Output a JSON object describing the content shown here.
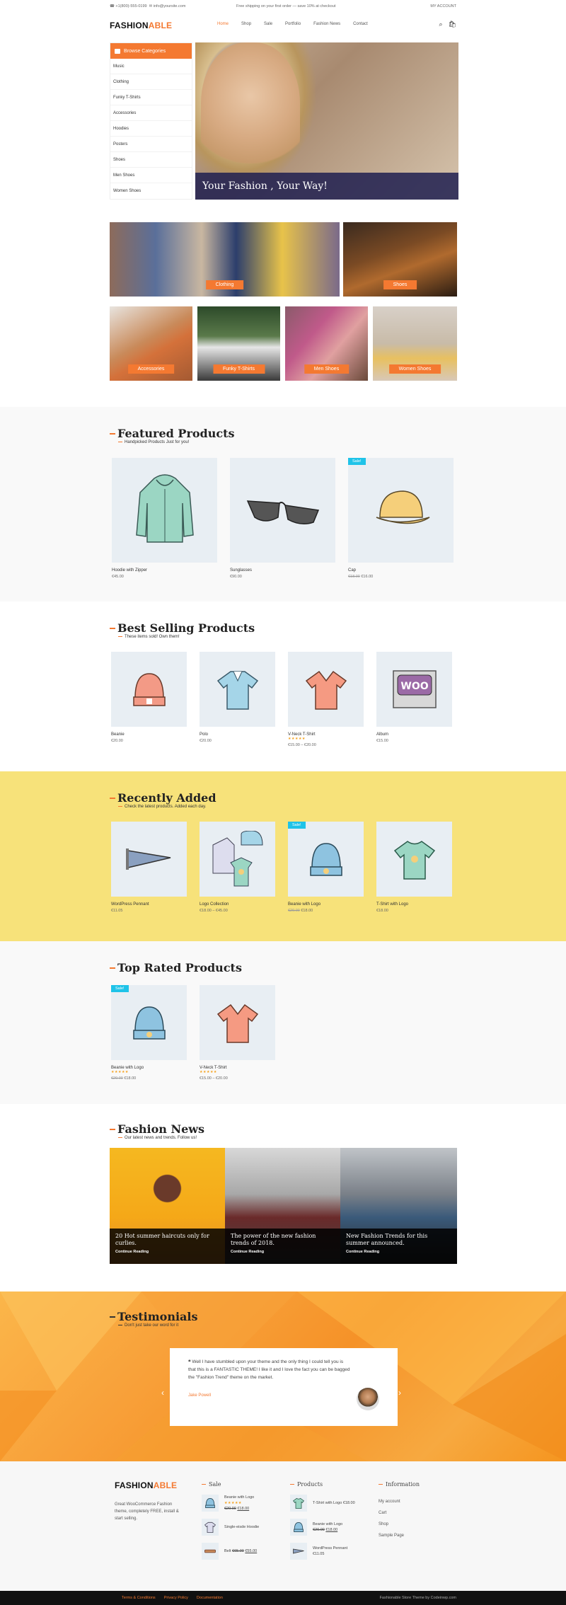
{
  "topbar": {
    "phone": "+1(800)-555-0199",
    "email": "info@yoursite.com",
    "promo": "Free shipping on your first order — save 10% at checkout",
    "account": "MY ACCOUNT"
  },
  "header": {
    "logo_a": "FASHION",
    "logo_b": "ABLE",
    "nav": [
      "Home",
      "Shop",
      "Sale",
      "Portfolio",
      "Fashion News",
      "Contact"
    ]
  },
  "categories": {
    "title": "Browse Categories",
    "items": [
      "Music",
      "Clothing",
      "Funky T-Shirts",
      "Accessories",
      "Hoodies",
      "Posters",
      "Shoes",
      "Men Shoes",
      "Women Shoes"
    ]
  },
  "hero": {
    "caption": "Your Fashion , Your Way!"
  },
  "tiles": {
    "clothing": "Clothing",
    "shoes": "Shoes",
    "accessories": "Accessories",
    "tshirts": "Funky T-Shirts",
    "men": "Men Shoes",
    "women": "Women Shoes"
  },
  "featured": {
    "title": "Featured Products",
    "subtitle": "Handpicked Products Just for you!",
    "products": [
      {
        "name": "Hoodie with Zipper",
        "price": "€45.00"
      },
      {
        "name": "Sunglasses",
        "price": "€90.00"
      },
      {
        "name": "Cap",
        "old": "€18.00",
        "price": "€16.00",
        "badge": "Sale!"
      }
    ]
  },
  "best": {
    "title": "Best Selling Products",
    "subtitle": "These items sold! Own them!",
    "products": [
      {
        "name": "Beanie",
        "price": "€20.00"
      },
      {
        "name": "Polo",
        "price": "€20.00"
      },
      {
        "name": "V-Neck T-Shirt",
        "price": "€15.00 – €20.00"
      },
      {
        "name": "Album",
        "price": "€15.00"
      }
    ]
  },
  "recent": {
    "title": "Recently Added",
    "subtitle": "Check the latest products. Added each day.",
    "products": [
      {
        "name": "WordPress Pennant",
        "price": "€11.05"
      },
      {
        "name": "Logo Collection",
        "price": "€18.00 – €45.00"
      },
      {
        "name": "Beanie with Logo",
        "old": "€20.00",
        "price": "€18.00",
        "badge": "Sale!"
      },
      {
        "name": "T-Shirt with Logo",
        "price": "€18.00"
      }
    ]
  },
  "toprated": {
    "title": "Top Rated Products",
    "products": [
      {
        "name": "Beanie with Logo",
        "old": "€20.00",
        "price": "€18.00",
        "badge": "Sale!",
        "stars": "★★★★★"
      },
      {
        "name": "V-Neck T-Shirt",
        "price": "€15.00 – €20.00",
        "stars": "★★★★★"
      }
    ]
  },
  "news": {
    "title": "Fashion News",
    "subtitle": "Our latest news and trends. Follow us!",
    "more": "Continue Reading",
    "items": [
      {
        "title": "20 Hot summer haircuts only for curlies."
      },
      {
        "title": "The power of the new fashion trends of 2018."
      },
      {
        "title": "New Fashion Trends for this summer announced."
      }
    ]
  },
  "testimonials": {
    "title": "Testimonials",
    "subtitle": "Don't just take our word for it",
    "quote": "Well I have stumbled upon your theme and the only thing I could tell you is that this is a FANTASTIC THEME! I like it and I love the fact you can be bagged the \"Fashion Trend\" theme on the market.",
    "author": "Jake Powell"
  },
  "footer": {
    "logo_a": "FASHION",
    "logo_b": "ABLE",
    "about": "Great WooCommerce Fashion theme, completely FREE, install & start selling.",
    "sale": {
      "title": "Sale",
      "items": [
        {
          "name": "Beanie with Logo",
          "old": "€20.00",
          "price": "€18.00",
          "stars": "★★★★★"
        },
        {
          "name": "Single-eisde Hoodie"
        },
        {
          "name": "Belt",
          "old": "€65.00",
          "price": "€55.00"
        }
      ]
    },
    "products": {
      "title": "Products",
      "items": [
        {
          "name": "T-Shirt with Logo",
          "price": "€18.00"
        },
        {
          "name": "Beanie with Logo",
          "old": "€20.00",
          "price": "€18.00"
        },
        {
          "name": "WordPress Pennant",
          "price": "€11.05"
        }
      ]
    },
    "info": {
      "title": "Information",
      "links": [
        "My account",
        "Cart",
        "Shop",
        "Sample Page"
      ]
    }
  },
  "bottom": {
    "left": [
      "Terms & Conditions",
      "Privacy Policy",
      "Documentation"
    ],
    "right": "Fashionable Store Theme by Codeinwp.com"
  },
  "colors": {
    "accent": "#f47931",
    "sale": "#1fc3e8",
    "navy": "#1e1e50",
    "yellow": "#f7e27a"
  }
}
